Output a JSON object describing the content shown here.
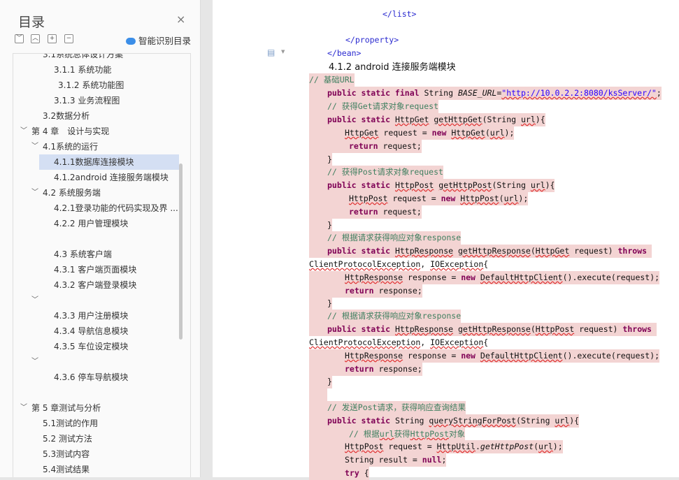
{
  "toc": {
    "title": "目录",
    "close": "×",
    "smart_label": "智能识别目录",
    "toolbar": [
      "﹀",
      "︿",
      "+",
      "−"
    ],
    "items": [
      "3.1系统总体设计方案",
      "3.1.1 系统功能",
      "3.1.2 系统功能图",
      "3.1.3 业务流程图",
      "3.2数据分析",
      "第 4 章　设计与实现",
      "4.1系统的运行",
      "4.1.1数据库连接模块",
      "4.1.2android 连接服务端模块",
      "4.2 系统服务端",
      "4.2.1登录功能的代码实现及界 ...",
      "4.2.2 用户管理模块",
      "4.3 系统客户端",
      "4.3.1 客户端页面模块",
      "4.3.2 客户端登录模块",
      "4.3.3 用户注册模块",
      "4.3.4 导航信息模块",
      "4.3.5 车位设定模块",
      "4.3.6 停车导航模块",
      "第 5 章测试与分析",
      "5.1测试的作用",
      "5.2 测试方法",
      "5.3测试内容",
      "5.4测试结果"
    ]
  },
  "doc": {
    "top": [
      "</list>",
      "</property>",
      "</bean>"
    ],
    "heading": "4.1.2 android 连接服务端模块",
    "code": [
      "// 基础URL",
      "public static final String BASE_URL=\"http://10.0.2.2:8080/ksServer/\";",
      "// 获得Get请求对象request",
      "public static HttpGet getHttpGet(String url){",
      "HttpGet request = new HttpGet(url);",
      "return request;",
      "}",
      "// 获得Post请求对象request",
      "public static HttpPost getHttpPost(String url){",
      "HttpPost request = new HttpPost(url);",
      "return request;",
      "}",
      "// 根据请求获得响应对象response",
      "public static HttpResponse getHttpResponse(HttpGet request) throws",
      "ClientProtocolException, IOException{",
      "HttpResponse response = new DefaultHttpClient().execute(request);",
      "return response;",
      "}",
      "// 根据请求获得响应对象response",
      "public static HttpResponse getHttpResponse(HttpPost request) throws",
      "ClientProtocolException, IOException{",
      "HttpResponse response = new DefaultHttpClient().execute(request);",
      "return response;",
      "}",
      "",
      "// 发送Post请求，获得响应查询结果",
      "public static String queryStringForPost(String url){",
      "// 根据url获得HttpPost对象",
      "HttpPost request = HttpUtil.getHttpPost(url);",
      "String result = null;",
      "try {"
    ]
  }
}
